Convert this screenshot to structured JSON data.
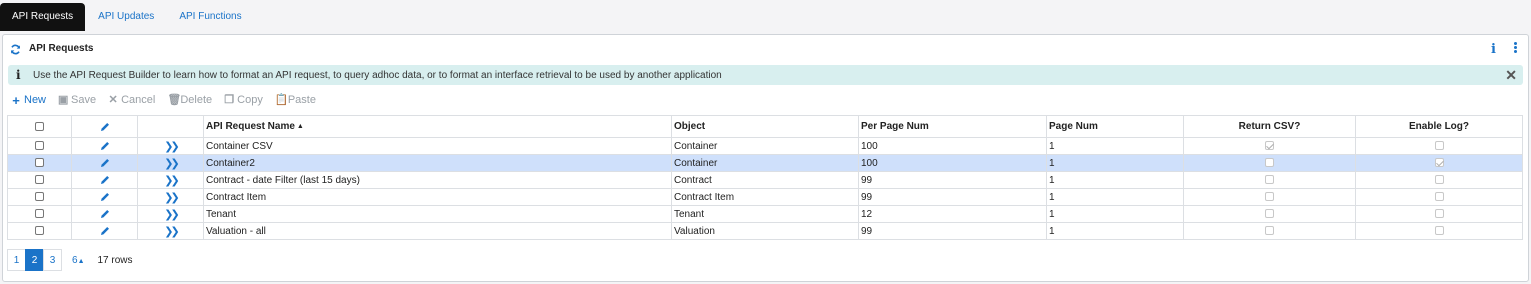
{
  "tabs": [
    {
      "label": "API Requests",
      "active": true
    },
    {
      "label": "API Updates",
      "active": false
    },
    {
      "label": "API Functions",
      "active": false
    }
  ],
  "panel": {
    "title": "API Requests",
    "info_label": "i",
    "icons": {
      "refresh": "refresh-icon",
      "info": "info-icon",
      "menu": "kebab-icon"
    }
  },
  "banner": {
    "icon": "i",
    "text": "Use the API Request Builder to learn how to format an API request, to query adhoc data, or to format an interface retrieval to be used by another application",
    "close": "✕"
  },
  "toolbar": {
    "new": {
      "icon": "+",
      "label": "New"
    },
    "save": {
      "icon": "▣",
      "label": "Save"
    },
    "cancel": {
      "icon": "✕",
      "label": "Cancel"
    },
    "delete": {
      "icon": "🗑",
      "label": "Delete"
    },
    "copy": {
      "icon": "❐",
      "label": "Copy"
    },
    "paste": {
      "icon": "📋",
      "label": "Paste"
    }
  },
  "grid": {
    "columns": {
      "name": "API Request Name",
      "name_sort": "▲",
      "object": "Object",
      "per_page": "Per Page Num",
      "page_num": "Page Num",
      "return_csv": "Return CSV?",
      "enable_log": "Enable Log?"
    },
    "rows": [
      {
        "name": "Container CSV",
        "object": "Container",
        "per_page": "100",
        "page_num": "1",
        "return_csv": true,
        "enable_log": false,
        "selected": false
      },
      {
        "name": "Container2",
        "object": "Container",
        "per_page": "100",
        "page_num": "1",
        "return_csv": false,
        "enable_log": true,
        "selected": true
      },
      {
        "name": "Contract - date Filter (last 15 days)",
        "object": "Contract",
        "per_page": "99",
        "page_num": "1",
        "return_csv": false,
        "enable_log": false,
        "selected": false
      },
      {
        "name": "Contract Item",
        "object": "Contract Item",
        "per_page": "99",
        "page_num": "1",
        "return_csv": false,
        "enable_log": false,
        "selected": false
      },
      {
        "name": "Tenant",
        "object": "Tenant",
        "per_page": "12",
        "page_num": "1",
        "return_csv": false,
        "enable_log": false,
        "selected": false
      },
      {
        "name": "Valuation - all",
        "object": "Valuation",
        "per_page": "99",
        "page_num": "1",
        "return_csv": false,
        "enable_log": false,
        "selected": false
      }
    ]
  },
  "pager": {
    "pages": [
      "1",
      "2",
      "3"
    ],
    "current": "2",
    "page_size": "6",
    "page_size_caret": "▲",
    "row_count": "17 rows"
  },
  "colors": {
    "accent": "#1a73c8",
    "selected_row": "#cfe0fb",
    "banner": "#d8efef",
    "active_tab": "#111111"
  }
}
